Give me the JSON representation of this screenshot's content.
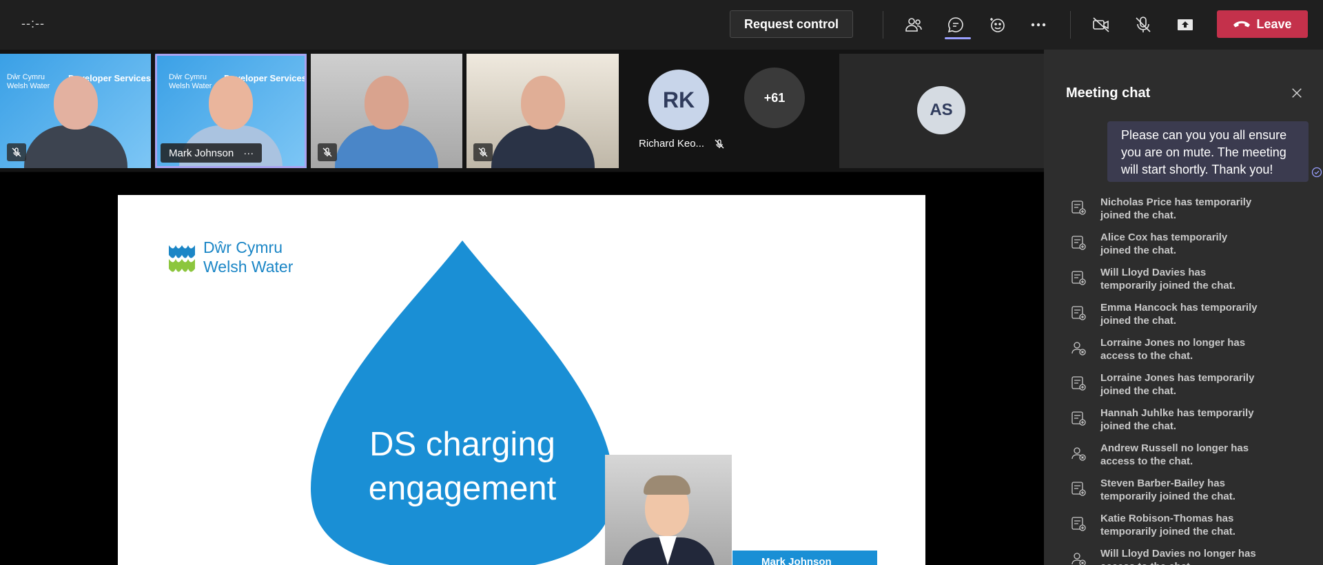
{
  "topbar": {
    "timer": "--:--",
    "request_control_label": "Request control",
    "leave_label": "Leave",
    "icons": [
      "people-icon",
      "chat-icon",
      "react-icon",
      "more-icon",
      "camera-off-icon",
      "mic-off-icon",
      "share-icon"
    ]
  },
  "gallery": {
    "tile1": {
      "brand_line1": "Dŵr Cymru",
      "brand_line2": "Welsh Water",
      "service": "Developer Services"
    },
    "tile2": {
      "brand_line1": "Dŵr Cymru",
      "brand_line2": "Welsh Water",
      "service": "Developer Services",
      "name": "Mark Johnson",
      "more": "···"
    },
    "rk": {
      "initials": "RK",
      "name": "Richard Keo..."
    },
    "overflow": {
      "label": "+61"
    },
    "as": {
      "initials": "AS"
    }
  },
  "slide": {
    "logo_line1": "Dŵr Cymru",
    "logo_line2": "Welsh Water",
    "title_line1": "DS charging",
    "title_line2": "engagement",
    "name_box": "Mark Johnson"
  },
  "chat": {
    "title": "Meeting chat",
    "bubble": "Please can you you all ensure you are on mute. The meeting will start shortly. Thank you!",
    "system_messages": [
      {
        "text": "Nicholas Price has temporarily joined the chat.",
        "icon": "chat-joined-icon"
      },
      {
        "text": "Alice Cox has temporarily joined the chat.",
        "icon": "chat-joined-icon"
      },
      {
        "text": "Will Lloyd Davies has temporarily joined the chat.",
        "icon": "chat-joined-icon"
      },
      {
        "text": "Emma Hancock has temporarily joined the chat.",
        "icon": "chat-joined-icon"
      },
      {
        "text": "Lorraine Jones no longer has access to the chat.",
        "icon": "person-removed-icon"
      },
      {
        "text": "Lorraine Jones has temporarily joined the chat.",
        "icon": "chat-joined-icon"
      },
      {
        "text": "Hannah Juhlke has temporarily joined the chat.",
        "icon": "chat-joined-icon"
      },
      {
        "text": "Andrew Russell no longer has access to the chat.",
        "icon": "person-removed-icon"
      },
      {
        "text": "Steven Barber-Bailey has temporarily joined the chat.",
        "icon": "chat-joined-icon"
      },
      {
        "text": "Katie Robison-Thomas has temporarily joined the chat.",
        "icon": "chat-joined-icon"
      },
      {
        "text": "Will Lloyd Davies no longer has access to the chat.",
        "icon": "person-removed-icon"
      }
    ]
  },
  "colors": {
    "accent": "#9aa0ff",
    "leave": "#c4314b",
    "brand_blue": "#1b86c6",
    "drop_blue": "#1a8fd5",
    "chat_bubble": "#3b3b4f"
  }
}
